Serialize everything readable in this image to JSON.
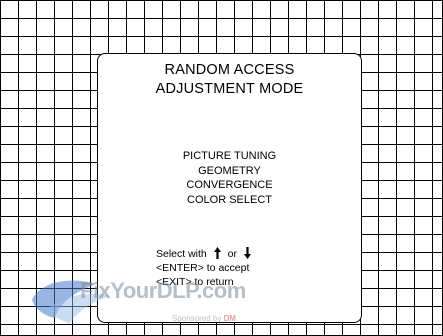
{
  "menu": {
    "title_line1": "RANDOM ACCESS",
    "title_line2": "ADJUSTMENT MODE",
    "items": [
      {
        "label": "PICTURE TUNING"
      },
      {
        "label": "GEOMETRY"
      },
      {
        "label": "CONVERGENCE"
      },
      {
        "label": "COLOR SELECT"
      }
    ]
  },
  "hints": {
    "select_prefix": "Select with",
    "select_or": "or",
    "up_icon": "arrow-up-icon",
    "down_icon": "arrow-down-icon",
    "enter_text": "<ENTER> to accept",
    "exit_text": "<EXIT> to return"
  },
  "watermark": {
    "logo_text": "FixYourDLP.com",
    "sponsored_text": "Sponsored by",
    "sponsor_brand": "DM"
  },
  "colors": {
    "grid": "#000000",
    "background": "#ffffff",
    "text": "#000000"
  }
}
